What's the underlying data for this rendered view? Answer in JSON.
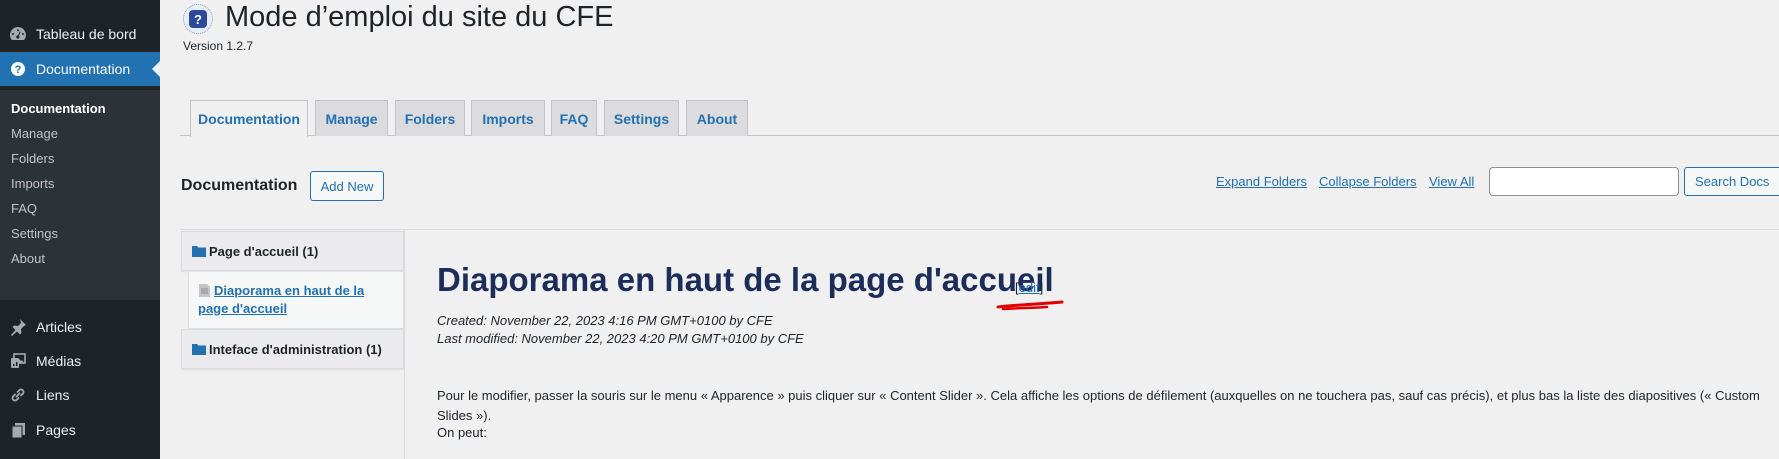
{
  "sidebar": {
    "top_items": [
      {
        "label": "Tableau de bord",
        "icon": "dashboard-icon"
      },
      {
        "label": "Documentation",
        "icon": "help-icon"
      }
    ],
    "submenu": [
      "Documentation",
      "Manage",
      "Folders",
      "Imports",
      "FAQ",
      "Settings",
      "About"
    ],
    "bottom_items": [
      {
        "label": "Articles",
        "icon": "pin-icon"
      },
      {
        "label": "Médias",
        "icon": "media-icon"
      },
      {
        "label": "Liens",
        "icon": "link-icon"
      },
      {
        "label": "Pages",
        "icon": "pages-icon"
      }
    ]
  },
  "header": {
    "title": "Mode d’emploi du site du CFE",
    "version": "Version 1.2.7",
    "logo_glyph": "?"
  },
  "tabs": [
    "Documentation",
    "Manage",
    "Folders",
    "Imports",
    "FAQ",
    "Settings",
    "About"
  ],
  "toolbar": {
    "heading": "Documentation",
    "add_new": "Add New",
    "expand": "Expand Folders",
    "collapse": "Collapse Folders",
    "view_all": "View All",
    "search_placeholder": "",
    "search_button": "Search Docs"
  },
  "tree": {
    "folders": [
      "Page d'accueil (1)",
      "Inteface d'administration (1)"
    ],
    "doc": "Diaporama en haut de la page d'accueil"
  },
  "article": {
    "title": "Diaporama en haut de la page d'accueil",
    "edit_open": "[",
    "edit": "edit",
    "edit_close": "]",
    "created": "Created: November 22, 2023 4:16 PM GMT+0100 by CFE",
    "modified": "Last modified: November 22, 2023 4:20 PM GMT+0100 by CFE",
    "body": "Pour le modifier, passer la souris sur le menu « Apparence » puis cliquer sur « Content Slider ». Cela affiche les options de défilement (auxquelles on ne touchera pas, sauf cas précis), et plus bas la liste des diapositives (« Custom Slides »).",
    "body2": "On peut:"
  },
  "colors": {
    "sidebar_bg": "#1d2327",
    "submenu_bg": "#2c3338",
    "accent": "#2271b1",
    "title_navy": "#1d2d5a",
    "annotation_red": "#e00000"
  }
}
